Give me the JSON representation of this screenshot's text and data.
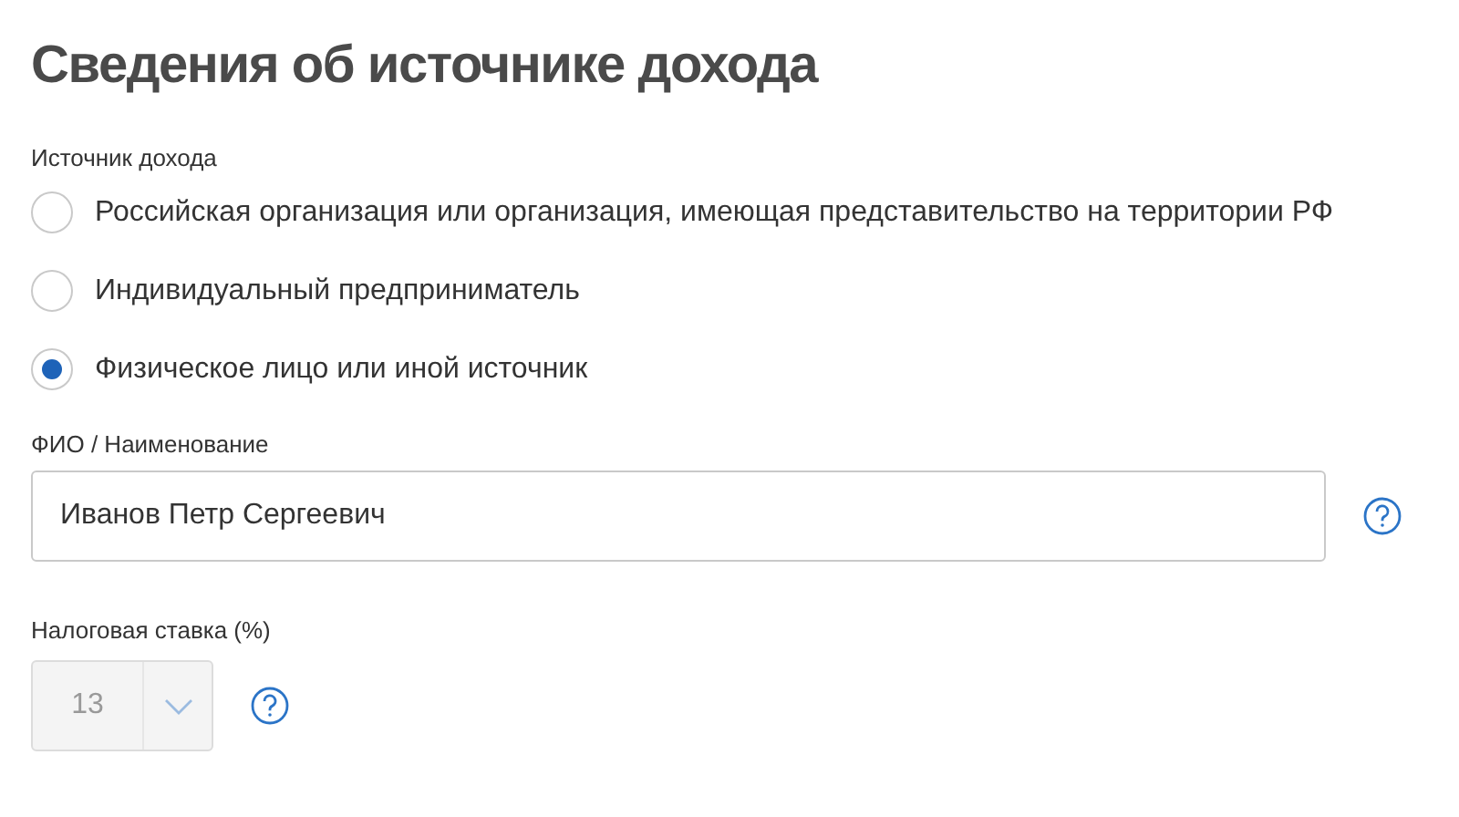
{
  "title": "Сведения об источнике дохода",
  "income_source": {
    "label": "Источник дохода",
    "options": [
      {
        "label": "Российская организация или организация, имеющая представительство на территории РФ",
        "selected": false
      },
      {
        "label": "Индивидуальный предприниматель",
        "selected": false
      },
      {
        "label": "Физическое лицо или иной источник",
        "selected": true
      }
    ]
  },
  "name_field": {
    "label": "ФИО / Наименование",
    "value": "Иванов Петр Сергеевич"
  },
  "tax_rate": {
    "label": "Налоговая ставка (%)",
    "value": "13",
    "disabled": true
  }
}
